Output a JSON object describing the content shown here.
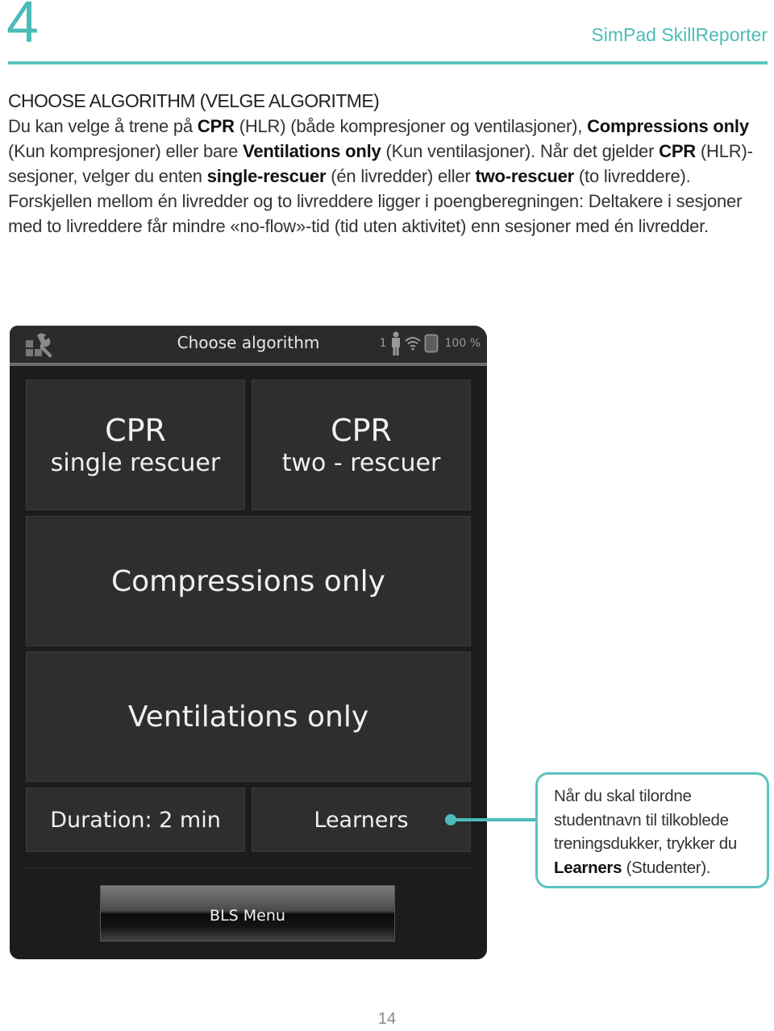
{
  "header": {
    "chapter_number": "4",
    "product_name": "SimPad SkillReporter"
  },
  "section": {
    "heading": "CHOOSE ALGORITHM (VELGE ALGORITME)",
    "body_segments": [
      {
        "text": "Du kan velge å trene på ",
        "bold": false
      },
      {
        "text": "CPR",
        "bold": true
      },
      {
        "text": " (HLR) (både kompresjoner og ventilasjoner), ",
        "bold": false
      },
      {
        "text": "Compressions only",
        "bold": true
      },
      {
        "text": " (Kun kompresjoner) eller bare ",
        "bold": false
      },
      {
        "text": "Ventilations only",
        "bold": true
      },
      {
        "text": " (Kun ventilasjoner). Når det gjelder ",
        "bold": false
      },
      {
        "text": "CPR",
        "bold": true
      },
      {
        "text": " (HLR)-sesjoner, velger du enten ",
        "bold": false
      },
      {
        "text": "single-rescuer",
        "bold": true
      },
      {
        "text": " (én livredder) eller ",
        "bold": false
      },
      {
        "text": "two-rescuer",
        "bold": true
      },
      {
        "text": " (to livreddere). Forskjellen mellom én livredder og to livreddere ligger i poengberegningen: Deltakere i sesjoner med to livreddere får mindre «no-flow»-tid (tid uten aktivitet) enn sesjoner med én livredder.",
        "bold": false
      }
    ]
  },
  "device": {
    "title": "Choose algorithm",
    "settings_icon": "settings-wrench-icon",
    "status": {
      "learner_count": "1",
      "learner_icon": "person-icon",
      "wifi_icon": "wifi-icon",
      "battery_icon": "battery-icon",
      "battery_level": "100 %"
    },
    "tiles": {
      "cpr_single": {
        "line1": "CPR",
        "line2": "single rescuer"
      },
      "cpr_two": {
        "line1": "CPR",
        "line2": "two - rescuer"
      },
      "compressions": {
        "label": "Compressions only"
      },
      "ventilations": {
        "label": "Ventilations only"
      },
      "duration": {
        "label": "Duration: 2 min"
      },
      "learners": {
        "label": "Learners"
      }
    },
    "bls_menu_label": "BLS Menu"
  },
  "callout": {
    "text_before": "Når du skal tilordne studentnavn til tilkoblede treningsdukker, trykker du ",
    "bold_text": "Learners",
    "text_after": " (Studenter)."
  },
  "page_number": "14",
  "colors": {
    "accent": "#4bbcb8",
    "device_bg": "#1c1c1c",
    "tile_bg": "#2e2e2e"
  }
}
